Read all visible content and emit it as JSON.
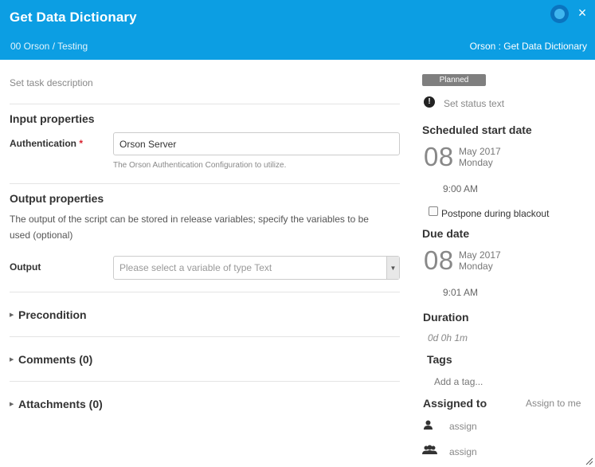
{
  "header": {
    "title": "Get Data Dictionary",
    "breadcrumb": "00 Orson / Testing",
    "task_path": "Orson : Get Data Dictionary",
    "close_icon": "×"
  },
  "task": {
    "description_placeholder": "Set task description"
  },
  "input_properties": {
    "title": "Input properties",
    "authentication_label": "Authentication",
    "required_marker": "*",
    "authentication_value": "Orson Server",
    "authentication_hint": "The Orson Authentication Configuration to utilize."
  },
  "output_properties": {
    "title": "Output properties",
    "description": "The output of the script can be stored in release variables; specify the variables to be used (optional)",
    "output_label": "Output",
    "output_placeholder": "Please select a variable of type Text"
  },
  "sections": {
    "precondition": "Precondition",
    "comments": "Comments (0)",
    "attachments": "Attachments (0)"
  },
  "status": {
    "badge": "Planned",
    "status_text_placeholder": "Set status text"
  },
  "scheduled_start": {
    "title": "Scheduled start date",
    "day": "08",
    "month_year": "May 2017",
    "weekday": "Monday",
    "time": "9:00 AM",
    "postpone_label": "Postpone during blackout"
  },
  "due": {
    "title": "Due date",
    "day": "08",
    "month_year": "May 2017",
    "weekday": "Monday",
    "time": "9:01 AM"
  },
  "duration": {
    "title": "Duration",
    "value": "0d 0h 1m"
  },
  "tags": {
    "title": "Tags",
    "placeholder": "Add a tag..."
  },
  "assigned": {
    "title": "Assigned to",
    "assign_to_me": "Assign to me",
    "user_assign": "assign",
    "team_assign": "assign"
  },
  "colors": {
    "header_bg": "#0c9ee3",
    "badge_bg": "#7f7f7f",
    "required": "#d9232f"
  },
  "icons": {
    "spinner": "spinner-icon",
    "close": "close-icon",
    "status": "exclamation-circle-icon",
    "user": "user-icon",
    "team": "team-icon",
    "caret": "caret-right-icon",
    "dropdown": "caret-down-icon"
  }
}
